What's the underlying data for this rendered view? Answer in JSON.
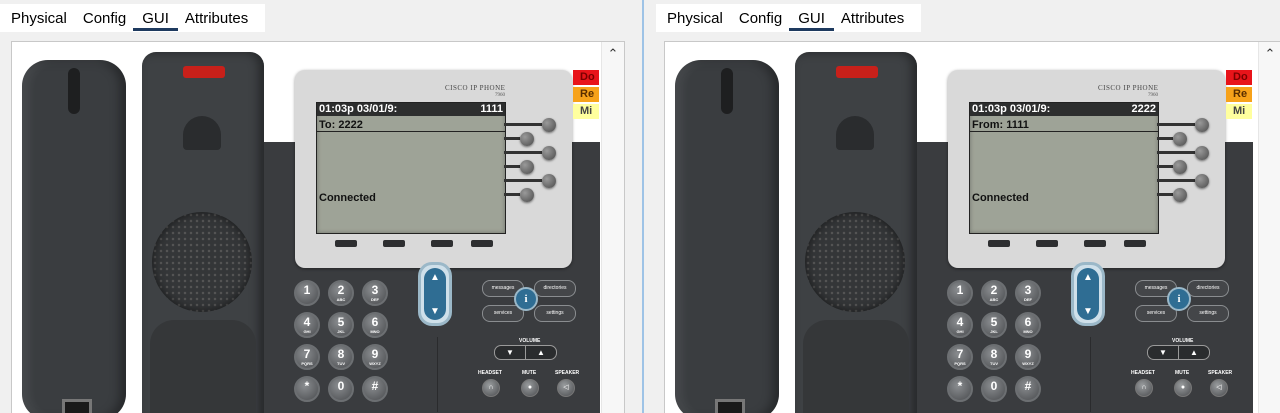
{
  "tabs": [
    "Physical",
    "Config",
    "GUI",
    "Attributes"
  ],
  "active_tab": "GUI",
  "colors": {
    "accent_underline": "#1e3a5f",
    "lcd": "#9ea397",
    "message_light": "#c8201a",
    "badge_red": "#e8141a",
    "badge_orange": "#f7a21a",
    "badge_yellow": "#ffff9e"
  },
  "phone_brand": "CISCO IP PHONE",
  "phone_model": "7960",
  "keypad": [
    {
      "digit": "1",
      "letters": ""
    },
    {
      "digit": "2",
      "letters": "ABC"
    },
    {
      "digit": "3",
      "letters": "DEF"
    },
    {
      "digit": "4",
      "letters": "GHI"
    },
    {
      "digit": "5",
      "letters": "JKL"
    },
    {
      "digit": "6",
      "letters": "MNO"
    },
    {
      "digit": "7",
      "letters": "PQRS"
    },
    {
      "digit": "8",
      "letters": "TUV"
    },
    {
      "digit": "9",
      "letters": "WXYZ"
    },
    {
      "digit": "*",
      "letters": ""
    },
    {
      "digit": "0",
      "letters": ""
    },
    {
      "digit": "#",
      "letters": ""
    }
  ],
  "function_buttons": {
    "messages": "messages",
    "directories": "directories",
    "services": "services",
    "settings": "settings",
    "info": "i"
  },
  "volume_label": "VOLUME",
  "headset_label": "HEADSET",
  "mute_label": "MUTE",
  "speaker_label": "SPEAKER",
  "nav_up": "▲",
  "nav_down": "▼",
  "badges": [
    "Do",
    "Re",
    "Mi"
  ],
  "phones": [
    {
      "time": "01:03p 03/01/9:",
      "extension": "1111",
      "call_line": "To: 2222",
      "status": "Connected"
    },
    {
      "time": "01:03p 03/01/9:",
      "extension": "2222",
      "call_line": "From: 1111",
      "status": "Connected"
    }
  ]
}
